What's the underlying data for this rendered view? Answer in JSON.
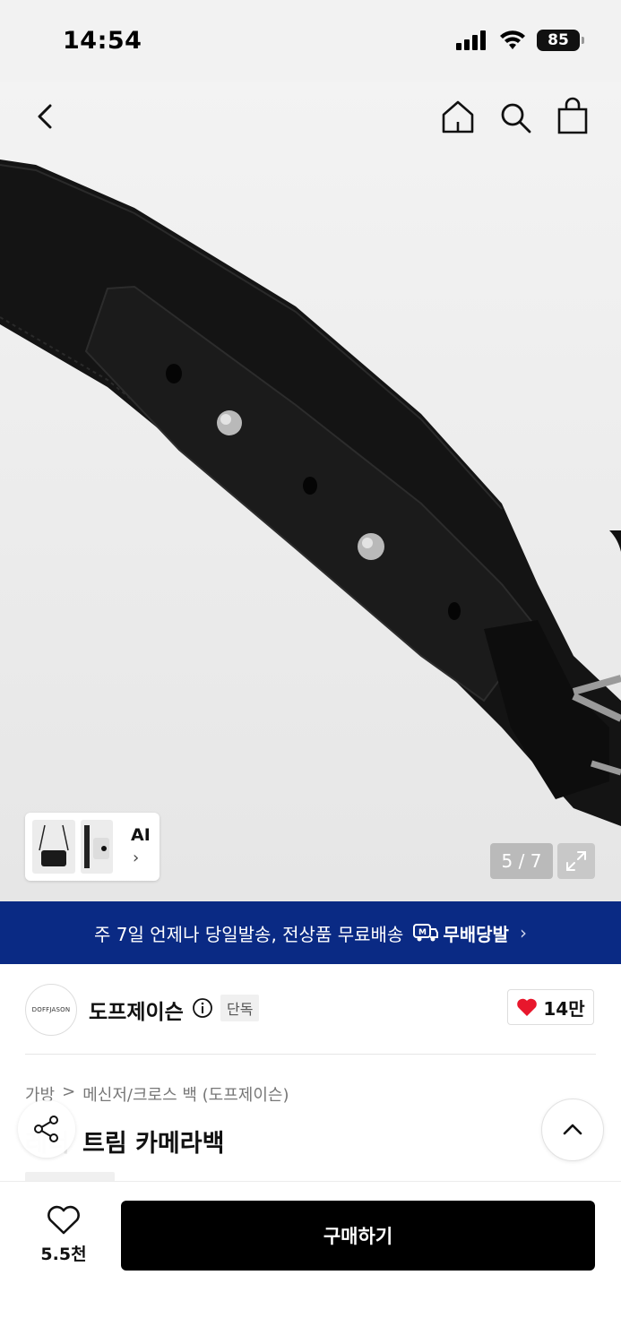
{
  "status_bar": {
    "time": "14:54",
    "battery": "85"
  },
  "gallery": {
    "ai_label": "AI",
    "ai_chevron": "›",
    "counter": "5 / 7"
  },
  "banner": {
    "text": "주 7일 언제나 당일발송, 전상품 무료배송",
    "logo_text": "무배당발",
    "chevron": "›"
  },
  "brand": {
    "logo_text": "DOFFJASON",
    "name": "도프제이슨",
    "badge": "단독",
    "likes": "14만"
  },
  "breadcrumb": {
    "category": "가방",
    "separator": ">",
    "subcategory": "메신저/크로스 백 (도프제이슨)"
  },
  "product": {
    "title": "트림 카메라백",
    "title_prefix_faded": "레더"
  },
  "bottom_bar": {
    "wish_count": "5.5천",
    "buy_label": "구매하기"
  },
  "colors": {
    "banner_bg": "#0a2a84",
    "heart": "#e8172c",
    "buy_bg": "#000000"
  },
  "icons": [
    "back-icon",
    "home-icon",
    "search-icon",
    "bag-icon",
    "expand-icon",
    "info-icon",
    "heart-icon",
    "share-icon",
    "chevron-up-icon",
    "truck-icon"
  ]
}
